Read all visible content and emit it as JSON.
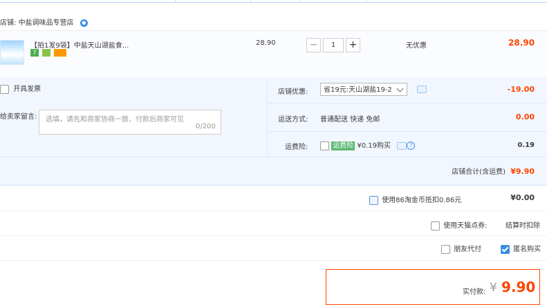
{
  "shop": {
    "label": "店铺:",
    "name": "中盐调味品专营店"
  },
  "item": {
    "title": "【拍1发9袋】中盐天山湖盐食...",
    "price": "28.90",
    "quantity": "1",
    "minus": "−",
    "plus": "+",
    "discount_text": "无优惠",
    "subtotal": "28.90",
    "tag_icons": [
      "seven-day-return-icon",
      "guarantee-icon",
      "credit-card-icon"
    ]
  },
  "options": {
    "invoice_label": "开具发票",
    "message_label": "给卖家留言:",
    "message_placeholder": "选填，请先和商家协商一致，付款后商家可见",
    "message_count": "0/200",
    "shop_discount_label": "店铺优惠:",
    "shop_discount_value": "省19元:天山湖盐19-2",
    "shop_discount_amount": "-19.00",
    "shipping_label": "运送方式:",
    "shipping_value": "普通配送 快递 免邮",
    "shipping_amount": "0.00",
    "insurance_label": "运费险:",
    "insurance_tag": "运费险",
    "insurance_value": "¥0.19购买",
    "insurance_help": "?",
    "insurance_amount": "0.19"
  },
  "shop_total": {
    "label": "店铺合计(含运费)",
    "value": "¥9.90"
  },
  "coins": {
    "label": "使用86淘金币抵扣0.86元",
    "value": "¥0.00"
  },
  "tmall_points": {
    "label": "使用天猫点券:",
    "value": "结算时扣除"
  },
  "friend_pay": {
    "label": "朋友代付"
  },
  "anonymous": {
    "label": "匿名购买",
    "checked": true
  },
  "pay": {
    "label": "实付款:",
    "currency": "¥",
    "amount": "9.90"
  },
  "colors": {
    "accent": "#f40",
    "blue": "#3a8ee6",
    "panel": "#f2f7ff"
  }
}
